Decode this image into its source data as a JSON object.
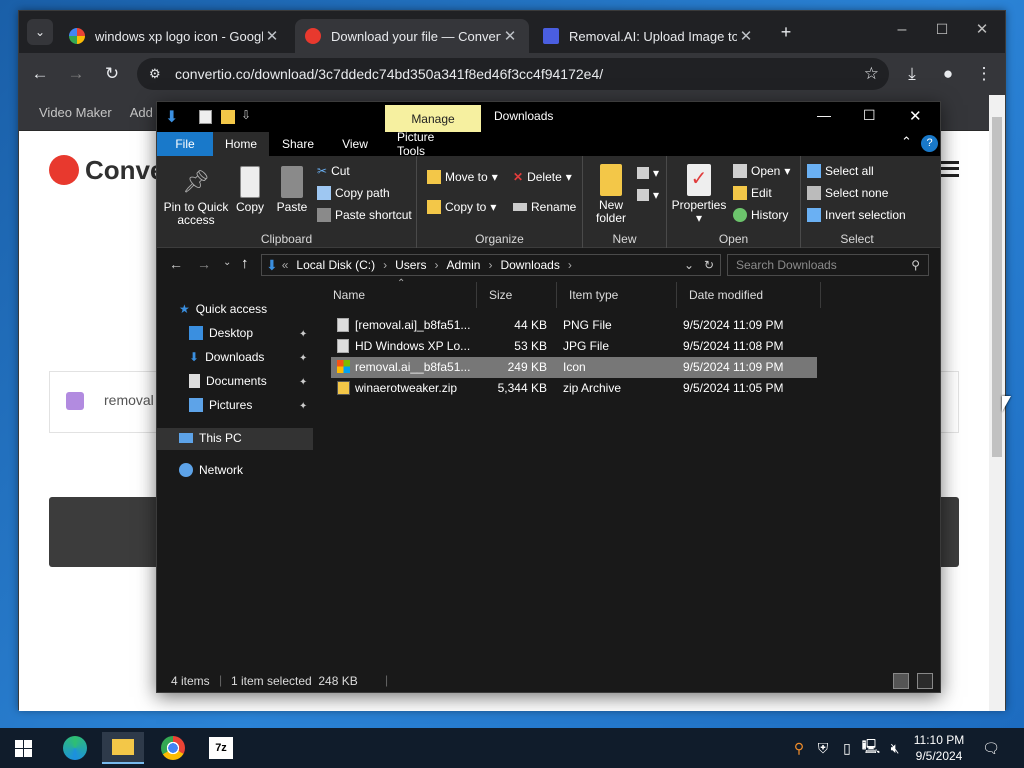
{
  "browser": {
    "tabs": [
      {
        "label": "windows xp logo icon - Google",
        "favicon": "google-icon"
      },
      {
        "label": "Download your file — Convertio",
        "favicon": "convertio-icon"
      },
      {
        "label": "Removal.AI: Upload Image to C",
        "favicon": "removal-ai-icon"
      }
    ],
    "url": "convertio.co/download/3c7ddedc74bd350a341f8ed46f3cc4f94172e4/",
    "bookmarks": [
      "Video Maker",
      "Add S"
    ],
    "page": {
      "brand": "Conve",
      "file_label": "removal"
    }
  },
  "explorer": {
    "title": "Downloads",
    "manage_label": "Manage",
    "ribbon_tabs": [
      "File",
      "Home",
      "Share",
      "View",
      "Picture Tools"
    ],
    "clipboard": {
      "pin": "Pin to Quick access",
      "copy": "Copy",
      "paste": "Paste",
      "cut": "Cut",
      "copy_path": "Copy path",
      "paste_shortcut": "Paste shortcut",
      "label": "Clipboard"
    },
    "organize": {
      "move_to": "Move to",
      "copy_to": "Copy to",
      "delete": "Delete",
      "rename": "Rename",
      "label": "Organize"
    },
    "new": {
      "new_folder": "New folder",
      "label": "New"
    },
    "open": {
      "properties": "Properties",
      "open": "Open",
      "edit": "Edit",
      "history": "History",
      "label": "Open"
    },
    "select": {
      "all": "Select all",
      "none": "Select none",
      "invert": "Invert selection",
      "label": "Select"
    },
    "breadcrumb": [
      "Local Disk (C:)",
      "Users",
      "Admin",
      "Downloads"
    ],
    "search_placeholder": "Search Downloads",
    "nav": {
      "quick_access": "Quick access",
      "desktop": "Desktop",
      "downloads": "Downloads",
      "documents": "Documents",
      "pictures": "Pictures",
      "this_pc": "This PC",
      "network": "Network"
    },
    "columns": {
      "name": "Name",
      "size": "Size",
      "type": "Item type",
      "date": "Date modified"
    },
    "files": [
      {
        "name": "[removal.ai]_b8fa51...",
        "size": "44 KB",
        "type": "PNG File",
        "date": "9/5/2024 11:09 PM"
      },
      {
        "name": "HD Windows XP Lo...",
        "size": "53 KB",
        "type": "JPG File",
        "date": "9/5/2024 11:08 PM"
      },
      {
        "name": "removal.ai__b8fa51...",
        "size": "249 KB",
        "type": "Icon",
        "date": "9/5/2024 11:09 PM"
      },
      {
        "name": "winaerotweaker.zip",
        "size": "5,344 KB",
        "type": "zip Archive",
        "date": "9/5/2024 11:05 PM"
      }
    ],
    "status": {
      "items": "4 items",
      "selected": "1 item selected  248 KB"
    }
  },
  "taskbar": {
    "time": "11:10 PM",
    "date": "9/5/2024"
  },
  "colors": {
    "accent": "#0078d7",
    "manage_tab": "#f6f0a0",
    "convertio_red": "#e8392e"
  }
}
